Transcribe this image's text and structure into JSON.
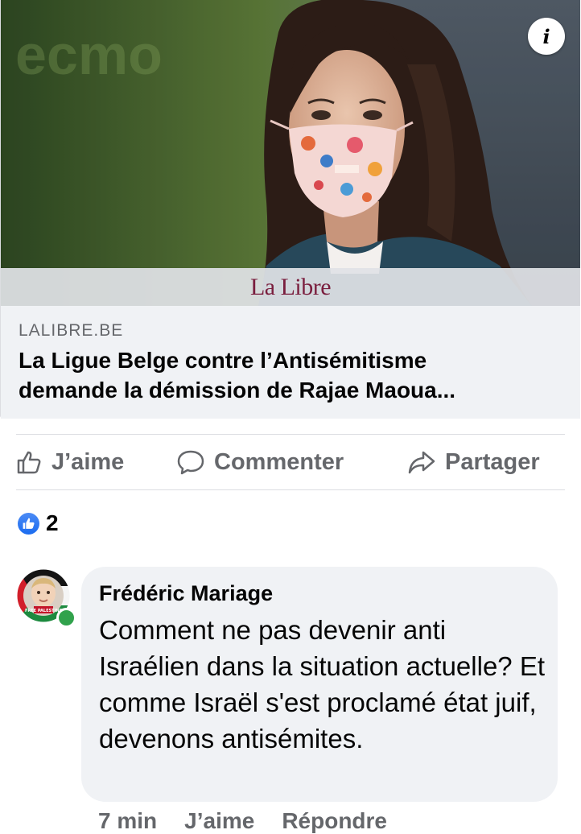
{
  "link_card": {
    "brand": "La Libre",
    "domain": "LALIBRE.BE",
    "headline_line1": "La Ligue Belge contre l’Antisémitisme",
    "headline_line2": "demande la démission de Rajae Maoua...",
    "info_icon": "info-icon"
  },
  "actions": {
    "like": "J’aime",
    "comment": "Commenter",
    "share": "Partager"
  },
  "reactions": {
    "count": "2",
    "icon": "like-reaction-icon",
    "color": "#1b74e4"
  },
  "comment": {
    "author": "Frédéric Mariage",
    "text": "Comment ne pas devenir anti Israélien dans la situation actuelle? Et comme Israël s'est proclamé état juif, devenons antisémites.",
    "avatar_badge": "FREE PALESTINE",
    "online": true,
    "time": "7 min",
    "like": "J’aime",
    "reply": "Répondre"
  },
  "colors": {
    "secondary_text": "#65676b",
    "card_bg": "#f0f2f5",
    "brand_text": "#7a1e3e",
    "online_green": "#31a24c"
  }
}
